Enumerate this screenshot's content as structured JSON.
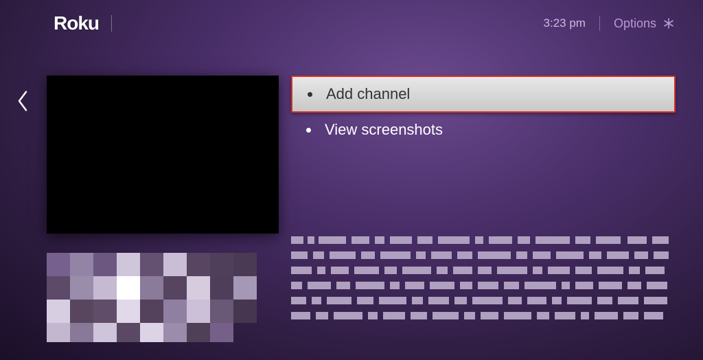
{
  "header": {
    "logo": "Roku",
    "time": "3:23  pm",
    "options_label": "Options"
  },
  "menu": {
    "items": [
      {
        "label": "Add channel",
        "selected": true
      },
      {
        "label": "View screenshots",
        "selected": false
      }
    ]
  }
}
